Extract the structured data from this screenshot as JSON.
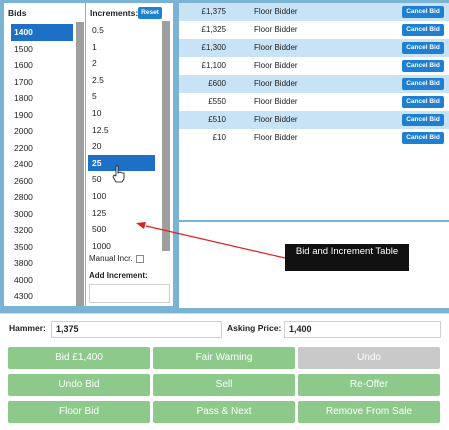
{
  "bids": {
    "title": "Bids",
    "items": [
      "1400",
      "1500",
      "1600",
      "1700",
      "1800",
      "1900",
      "2000",
      "2200",
      "2400",
      "2600",
      "2800",
      "3000",
      "3200",
      "3500",
      "3800",
      "4000",
      "4300"
    ],
    "selected": "1400"
  },
  "increments": {
    "title": "Increments:",
    "reset_label": "Reset",
    "items": [
      "0.5",
      "1",
      "2",
      "2.5",
      "5",
      "10",
      "12.5",
      "20",
      "25",
      "50",
      "100",
      "125",
      "500",
      "1000"
    ],
    "selected": "25",
    "manual_label": "Manual Incr.",
    "add_label": "Add Increment:"
  },
  "bidders": {
    "rows": [
      {
        "amount": "£1,375",
        "name": "Floor Bidder",
        "button": "Cancel Bid"
      },
      {
        "amount": "£1,325",
        "name": "Floor Bidder",
        "button": "Cancel Bid"
      },
      {
        "amount": "£1,300",
        "name": "Floor Bidder",
        "button": "Cancel Bid"
      },
      {
        "amount": "£1,100",
        "name": "Floor Bidder",
        "button": "Cancel Bid"
      },
      {
        "amount": "£600",
        "name": "Floor Bidder",
        "button": "Cancel Bid"
      },
      {
        "amount": "£550",
        "name": "Floor Bidder",
        "button": "Cancel Bid"
      },
      {
        "amount": "£510",
        "name": "Floor Bidder",
        "button": "Cancel Bid"
      },
      {
        "amount": "£10",
        "name": "Floor Bidder",
        "button": "Cancel Bid"
      }
    ]
  },
  "callout": {
    "text": "Bid and Increment Table"
  },
  "hammer": {
    "label": "Hammer:",
    "value": "1,375"
  },
  "asking": {
    "label": "Asking Price:",
    "value": "1,400"
  },
  "actions": {
    "bid": "Bid £1,400",
    "fair_warning": "Fair Warning",
    "undo": "Undo",
    "undo_bid": "Undo Bid",
    "sell": "Sell",
    "re_offer": "Re-Offer",
    "floor_bid": "Floor Bid",
    "pass_next": "Pass & Next",
    "remove": "Remove From Sale"
  },
  "colors": {
    "frame": "#7ab3d4",
    "selection": "#1e6fc6",
    "button_blue": "#1f7fd0",
    "row_alt": "#c8e3f5",
    "action_green": "#8cc98a",
    "action_disabled": "#c9c9c9"
  }
}
